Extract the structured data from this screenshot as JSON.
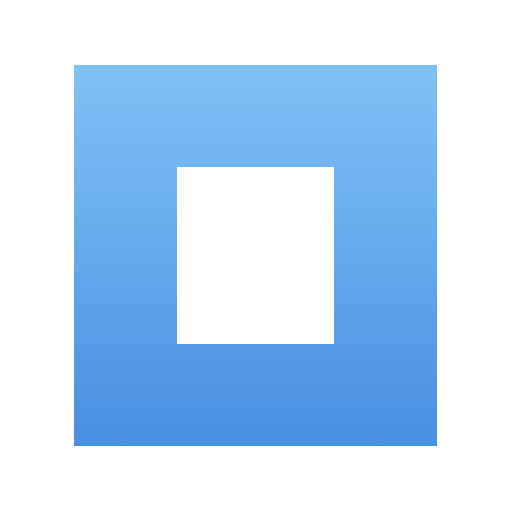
{
  "icon": {
    "name": "stop-square-icon",
    "colors": {
      "gradient_top": "#80c2f4",
      "gradient_bottom": "#4a8ee2",
      "inner": "#ffffff",
      "background": "#ffffff"
    }
  }
}
